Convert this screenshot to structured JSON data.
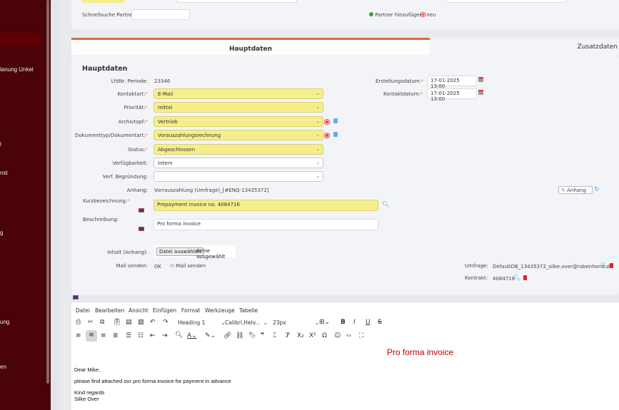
{
  "sidebar": {
    "items": [
      "lanung Unkel",
      "l",
      "nst",
      "g",
      "ung",
      "en"
    ]
  },
  "partner": {
    "quicksearch_label": "Schnellsuche Partner:",
    "add_label": "Partner hinzufügen",
    "new_label": "neu"
  },
  "tabs": [
    "Hauptdaten",
    "Zusatzdaten"
  ],
  "section_title": "Hauptdaten",
  "form": {
    "lfdnr_label": "LfdNr. Periode:",
    "lfdnr_value": "23346",
    "kontaktart_label": "Kontaktart:",
    "kontaktart_value": "E-Mail",
    "prioritaet_label": "Priorität:",
    "prioritaet_value": "mittel",
    "archivtopf_label": "Archivtopf:",
    "archivtopf_value": "Vertrieb",
    "doktyp_label": "Dokumenttyp/Dokumentart:",
    "doktyp_value": "Vorauszahlungsrechnung",
    "status_label": "Status:",
    "status_value": "Abgeschlossen",
    "verfuegbarkeit_label": "Verfügbarkeit:",
    "verfuegbarkeit_value": "Intern",
    "begruendung_label": "Verf. Begründung:",
    "begruendung_value": "",
    "anhang_label": "Anhang:",
    "anhang_value": "Vorrauszahlung (Umfrage)_[#ENQ-13435372]",
    "anhang_button": "Anhang",
    "kurz_label": "Kurzbezeichnung:",
    "kurz_value": "Prepayment invoice no. 4084716",
    "beschreibung_label": "Beschreibung:",
    "beschreibung_value": "Pro forma invoice",
    "inhalt_label": "Inhalt (Anhang):",
    "file_button": "Datei auswählen",
    "file_none": "Keine ausgewählt",
    "mail_label": "Mail senden:",
    "mail_status": "OK",
    "mail_link": "Mail senden",
    "erstellung_label": "Erstellungsdatum:",
    "erstellung_value": "17-01-2025  13:00",
    "kontaktdatum_label": "Kontaktdatum:",
    "kontaktdatum_value": "17-01-2025  13:00",
    "umfrage_label": "Umfrage:",
    "umfrage_value": "DefaultDB_13435372_silke.over@rabenhorst.de",
    "kontrakt_label": "Kontrakt:",
    "kontrakt_value": "4084716",
    "required_mark": "*"
  },
  "editor": {
    "menu": [
      "Datei",
      "Bearbeiten",
      "Ansicht",
      "Einfügen",
      "Format",
      "Werkzeuge",
      "Tabelle"
    ],
    "block_format": "Heading 1",
    "font": "Calibri,Helv...",
    "size": "23px",
    "heading": "Pro forma invoice",
    "lines": [
      "Dear Mike,",
      "please find attached our pro forma invoice for payment in advance",
      "Kind regards",
      "Silke Over"
    ],
    "heading_color": "#c00000"
  }
}
